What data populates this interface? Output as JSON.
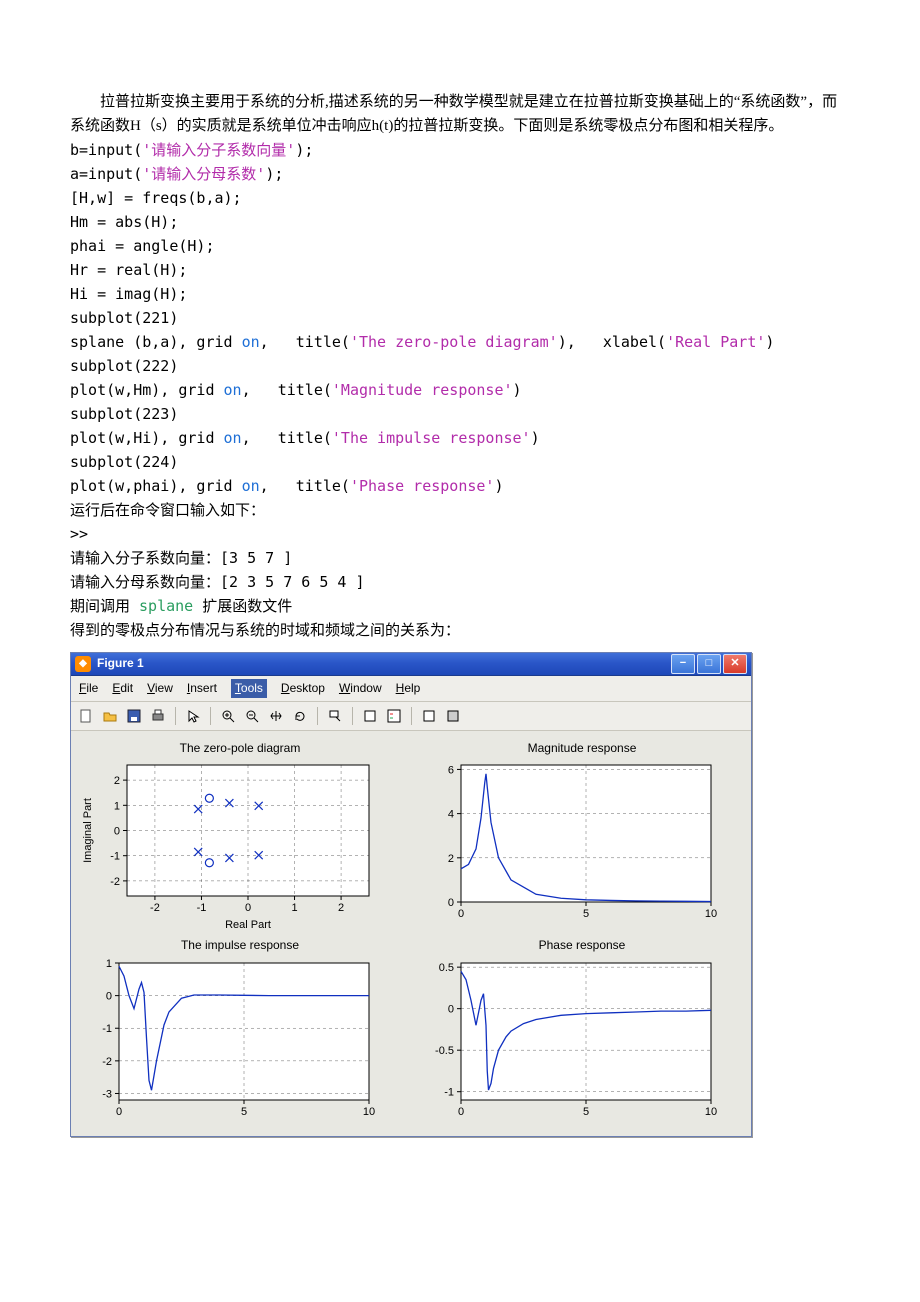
{
  "prose": {
    "p1": "　　拉普拉斯变换主要用于系统的分析,描述系统的另一种数学模型就是建立在拉普拉斯变换基础上的“系统函数”，而系统函数H（s）的实质就是系统单位冲击响应h(t)的拉普拉斯变换。下面则是系统零极点分布图和相关程序。"
  },
  "code": {
    "l1a": "b=input(",
    "l1b": "'请输入分子系数向量'",
    "l1c": ");",
    "l2a": "a=input(",
    "l2b": "'请输入分母系数'",
    "l2c": ");",
    "l3": "[H,w] = freqs(b,a);",
    "l4": "Hm = abs(H);",
    "l5": "phai = angle(H);",
    "l6": "Hr = real(H);",
    "l7": "Hi = imag(H);",
    "l8": "subplot(221)",
    "l9a": "splane (b,a), grid ",
    "l9b": "on",
    "l9c": ",   title(",
    "l9d": "'The zero-pole diagram'",
    "l9e": "),   xlabel(",
    "l9f": "'Real Part'",
    "l9g": ")",
    "l10": "subplot(222)",
    "l11a": "plot(w,Hm), grid ",
    "l11b": "on",
    "l11c": ",   title(",
    "l11d": "'Magnitude response'",
    "l11e": ")",
    "l12": "subplot(223)",
    "l13a": "plot(w,Hi), grid ",
    "l13b": "on",
    "l13c": ",   title(",
    "l13d": "'The impulse response'",
    "l13e": ")",
    "l14": "subplot(224)",
    "l15a": "plot(w,phai), grid ",
    "l15b": "on",
    "l15c": ",   title(",
    "l15d": "'Phase response'",
    "l15e": ")"
  },
  "runtext": {
    "t1": "运行后在命令窗口输入如下：",
    "t2": ">>",
    "t3": "请输入分子系数向量：[3 5 7 ]",
    "t4": "请输入分母系数向量：[2 3 5 7 6 5 4 ]",
    "t5a": "期间调用 ",
    "t5b": "splane ",
    "t5c": "扩展函数文件",
    "t6": "得到的零极点分布情况与系统的时域和频域之间的关系为："
  },
  "figure": {
    "title": "Figure 1",
    "menus": [
      "File",
      "Edit",
      "View",
      "Insert",
      "Tools",
      "Desktop",
      "Window",
      "Help"
    ],
    "menu_selected_index": 4,
    "subplot_titles": {
      "t221": "The zero-pole diagram",
      "t222": "Magnitude response",
      "t223": "The impulse response",
      "t224": "Phase response"
    },
    "axis_labels": {
      "x221": "Real Part",
      "y221": "Imaginal Part"
    }
  },
  "chart_data": [
    {
      "id": "zero_pole",
      "type": "scatter",
      "title": "The zero-pole diagram",
      "xlabel": "Real Part",
      "ylabel": "Imaginal Part",
      "xlim": [
        -2.6,
        2.6
      ],
      "ylim": [
        -2.6,
        2.6
      ],
      "xticks": [
        -2,
        -1,
        0,
        1,
        2
      ],
      "yticks": [
        -2,
        -1,
        0,
        1,
        2
      ],
      "grid": true,
      "zeros": [
        [
          -0.83,
          1.28
        ],
        [
          -0.83,
          -1.28
        ]
      ],
      "poles": [
        [
          -1.07,
          0.85
        ],
        [
          -1.07,
          -0.85
        ],
        [
          -0.4,
          1.09
        ],
        [
          -0.4,
          -1.09
        ],
        [
          0.23,
          0.98
        ],
        [
          0.23,
          -0.98
        ]
      ]
    },
    {
      "id": "magnitude",
      "type": "line",
      "title": "Magnitude response",
      "xlim": [
        0,
        10
      ],
      "ylim": [
        0,
        6.2
      ],
      "xticks": [
        0,
        5,
        10
      ],
      "yticks": [
        0,
        2,
        4,
        6
      ],
      "grid": true,
      "x": [
        0,
        0.3,
        0.6,
        0.8,
        0.95,
        1.0,
        1.05,
        1.2,
        1.5,
        2,
        3,
        4,
        5,
        6,
        7,
        8,
        9,
        10
      ],
      "y": [
        1.5,
        1.7,
        2.4,
        3.8,
        5.4,
        5.8,
        5.2,
        3.6,
        2.0,
        1.0,
        0.35,
        0.17,
        0.1,
        0.07,
        0.05,
        0.04,
        0.03,
        0.02
      ]
    },
    {
      "id": "impulse",
      "type": "line",
      "title": "The impulse response",
      "xlim": [
        0,
        10
      ],
      "ylim": [
        -3.2,
        1.0
      ],
      "xticks": [
        0,
        5,
        10
      ],
      "yticks": [
        -3,
        -2,
        -1,
        0,
        1
      ],
      "grid": true,
      "x": [
        0,
        0.2,
        0.4,
        0.6,
        0.8,
        0.9,
        1.0,
        1.1,
        1.2,
        1.3,
        1.5,
        1.8,
        2.0,
        2.5,
        3,
        4,
        5,
        6,
        7,
        8,
        9,
        10
      ],
      "y": [
        0.9,
        0.6,
        0.0,
        -0.4,
        0.2,
        0.4,
        0.1,
        -1.3,
        -2.6,
        -2.9,
        -2.0,
        -0.9,
        -0.5,
        -0.08,
        0.02,
        0.02,
        0.01,
        0.0,
        0.0,
        0.0,
        0.0,
        0.0
      ]
    },
    {
      "id": "phase",
      "type": "line",
      "title": "Phase response",
      "xlim": [
        0,
        10
      ],
      "ylim": [
        -1.1,
        0.55
      ],
      "xticks": [
        0,
        5,
        10
      ],
      "yticks": [
        -1,
        -0.5,
        0,
        0.5
      ],
      "grid": true,
      "x": [
        0,
        0.2,
        0.4,
        0.6,
        0.7,
        0.8,
        0.9,
        1.0,
        1.05,
        1.1,
        1.2,
        1.3,
        1.5,
        1.8,
        2.0,
        2.5,
        3,
        4,
        5,
        6,
        7,
        8,
        9,
        10
      ],
      "y": [
        0.45,
        0.35,
        0.1,
        -0.2,
        -0.05,
        0.1,
        0.18,
        -0.2,
        -0.75,
        -0.98,
        -0.9,
        -0.72,
        -0.5,
        -0.34,
        -0.27,
        -0.18,
        -0.13,
        -0.08,
        -0.06,
        -0.05,
        -0.04,
        -0.03,
        -0.03,
        -0.02
      ]
    }
  ]
}
